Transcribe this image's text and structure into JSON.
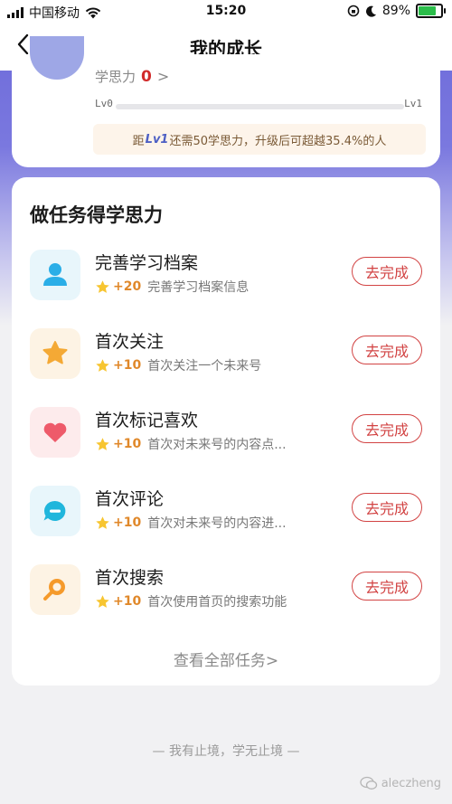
{
  "status_bar": {
    "carrier": "中国移动",
    "time": "15:20",
    "battery_percent": "89%"
  },
  "nav": {
    "title": "我的成长",
    "back_icon": "chevron-left-icon"
  },
  "level": {
    "label": "学思力",
    "value": "0",
    "arrow": ">",
    "start": "Lv0",
    "end": "Lv1",
    "progress": 0.0,
    "hint_prefix": "距",
    "hint_tag": "Lv1",
    "hint_suffix": "还需50学思力，升级后可超越35.4%的人"
  },
  "tasks_section": {
    "title": "做任务得学思力",
    "view_all": "查看全部任务>",
    "items": [
      {
        "name": "完善学习档案",
        "points": "+20",
        "desc": "完善学习档案信息",
        "button": "去完成",
        "icon": "user-profile-icon",
        "bg": "#e8f6fb",
        "color": "#2aaee7"
      },
      {
        "name": "首次关注",
        "points": "+10",
        "desc": "首次关注一个未来号",
        "button": "去完成",
        "icon": "star-icon",
        "bg": "#fdf3e4",
        "color": "#f4a935"
      },
      {
        "name": "首次标记喜欢",
        "points": "+10",
        "desc": "首次对未来号的内容点...",
        "button": "去完成",
        "icon": "heart-icon",
        "bg": "#fdebec",
        "color": "#ee5a6a"
      },
      {
        "name": "首次评论",
        "points": "+10",
        "desc": "首次对未来号的内容进...",
        "button": "去完成",
        "icon": "comment-bubble-icon",
        "bg": "#e8f6fb",
        "color": "#20b6dc"
      },
      {
        "name": "首次搜索",
        "points": "+10",
        "desc": "首次使用首页的搜索功能",
        "button": "去完成",
        "icon": "search-icon",
        "bg": "#fdf3e4",
        "color": "#f59a2b"
      }
    ]
  },
  "footer": {
    "motto": "— 我有止境，学无止境 —",
    "watermark": "aleczheng"
  },
  "colors": {
    "accent_purple": "#6b68d8",
    "button_red": "#d24343",
    "points_orange": "#e0882a"
  }
}
